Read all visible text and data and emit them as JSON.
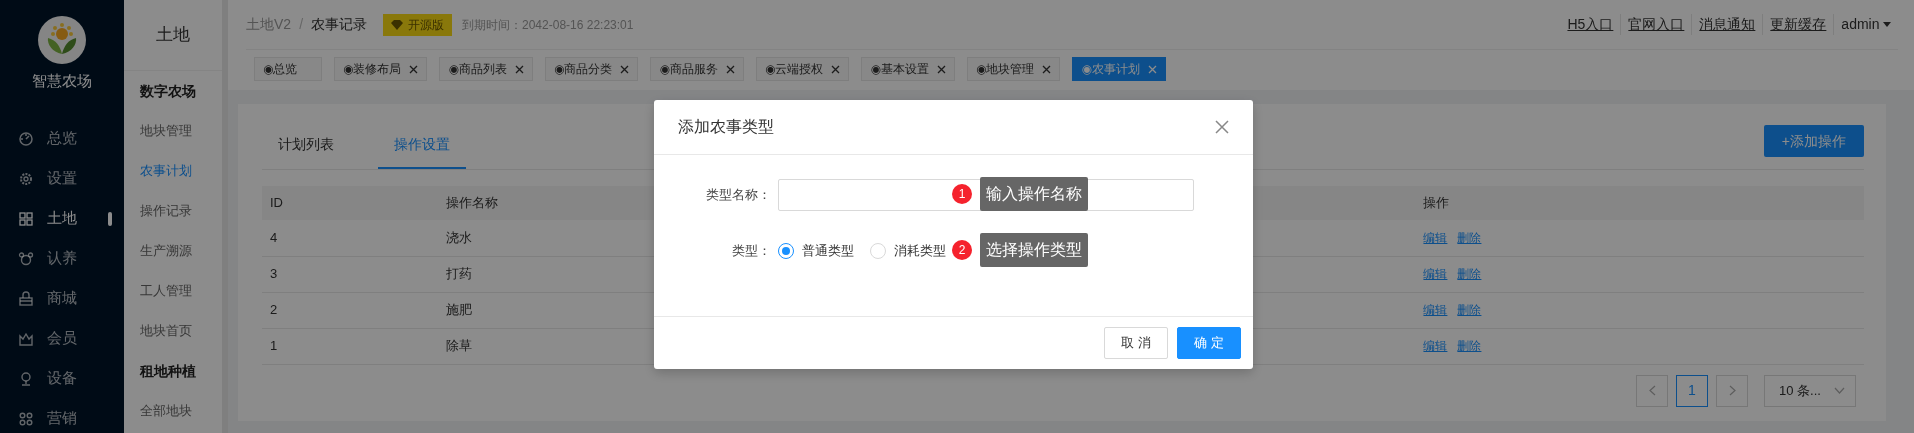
{
  "brand": {
    "name": "智慧农场"
  },
  "main_menu": [
    {
      "label": "总览",
      "selected": false
    },
    {
      "label": "设置",
      "selected": false
    },
    {
      "label": "土地",
      "selected": true
    },
    {
      "label": "认养",
      "selected": false
    },
    {
      "label": "商城",
      "selected": false
    },
    {
      "label": "会员",
      "selected": false
    },
    {
      "label": "设备",
      "selected": false
    },
    {
      "label": "营销",
      "selected": false
    }
  ],
  "sub_menu": {
    "title": "土地",
    "groups": [
      {
        "title": "数字农场",
        "items": [
          {
            "label": "地块管理",
            "selected": false
          },
          {
            "label": "农事计划",
            "selected": true
          },
          {
            "label": "操作记录",
            "selected": false
          },
          {
            "label": "生产溯源",
            "selected": false
          },
          {
            "label": "工人管理",
            "selected": false
          },
          {
            "label": "地块首页",
            "selected": false
          }
        ]
      },
      {
        "title": "租地种植",
        "items": [
          {
            "label": "全部地块",
            "selected": false
          }
        ]
      }
    ]
  },
  "breadcrumb": [
    "土地V2",
    "农事记录"
  ],
  "breadcrumb_separator": "/",
  "edition_badge": "开源版",
  "expiry": "到期时间：2042-08-16 22:23:01",
  "top_links": [
    "H5入口",
    "官网入口",
    "消息通知",
    "更新缓存"
  ],
  "user": "admin",
  "page_tabs": [
    {
      "label": "◉总览",
      "closable": false,
      "selected": false
    },
    {
      "label": "◉装修布局",
      "closable": true,
      "selected": false
    },
    {
      "label": "◉商品列表",
      "closable": true,
      "selected": false
    },
    {
      "label": "◉商品分类",
      "closable": true,
      "selected": false
    },
    {
      "label": "◉商品服务",
      "closable": true,
      "selected": false
    },
    {
      "label": "◉云端授权",
      "closable": true,
      "selected": false
    },
    {
      "label": "◉基本设置",
      "closable": true,
      "selected": false
    },
    {
      "label": "◉地块管理",
      "closable": true,
      "selected": false
    },
    {
      "label": "◉农事计划",
      "closable": true,
      "selected": true
    }
  ],
  "content_tabs": [
    {
      "label": "计划列表",
      "selected": false
    },
    {
      "label": "操作设置",
      "selected": true
    }
  ],
  "add_button": "+添加操作",
  "table": {
    "columns": [
      "ID",
      "操作名称",
      "操作"
    ],
    "rows": [
      {
        "id": "4",
        "name": "浇水",
        "actions": [
          "编辑",
          "删除"
        ]
      },
      {
        "id": "3",
        "name": "打药",
        "actions": [
          "编辑",
          "删除"
        ]
      },
      {
        "id": "2",
        "name": "施肥",
        "actions": [
          "编辑",
          "删除"
        ]
      },
      {
        "id": "1",
        "name": "除草",
        "actions": [
          "编辑",
          "删除"
        ]
      }
    ]
  },
  "pagination": {
    "pages": [
      {
        "label": "1",
        "selected": true
      }
    ],
    "page_size": "10 条..."
  },
  "dialog": {
    "title": "添加农事类型",
    "fields": [
      {
        "kind": "text",
        "label": "类型名称：",
        "hint": {
          "number": "1",
          "text": "输入操作名称"
        }
      },
      {
        "kind": "radio",
        "label": "类型：",
        "options": [
          {
            "label": "普通类型",
            "selected": true
          },
          {
            "label": "消耗类型",
            "selected": false
          }
        ],
        "hint": {
          "number": "2",
          "text": "选择操作类型"
        }
      }
    ],
    "buttons": [
      {
        "label": "取 消",
        "kind": "default"
      },
      {
        "label": "确 定",
        "kind": "primary"
      }
    ]
  }
}
